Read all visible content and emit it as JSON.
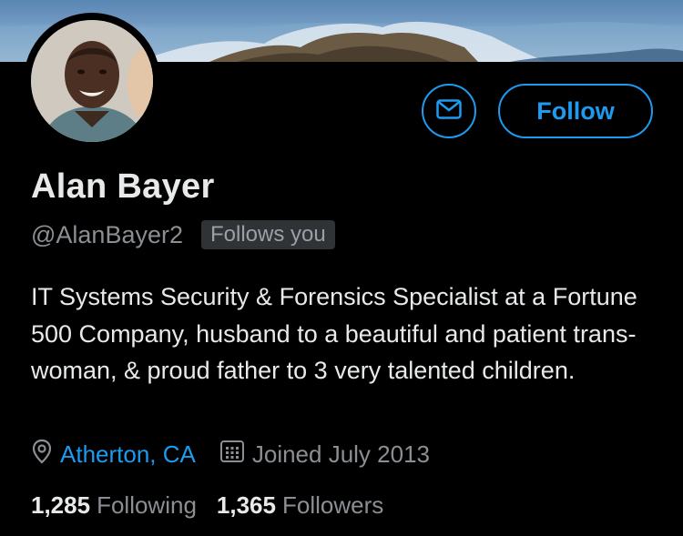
{
  "profile": {
    "name": "Alan Bayer",
    "handle": "@AlanBayer2",
    "follows_you": "Follows you",
    "bio": "IT Systems Security & Forensics Specialist at a Fortune 500 Company, husband to a beautiful and patient trans-woman, & proud father to 3 very talented children.",
    "location": "Atherton, CA",
    "joined": "Joined July 2013"
  },
  "actions": {
    "follow_label": "Follow",
    "message_icon": "mail-icon"
  },
  "stats": {
    "following_count": "1,285",
    "following_label": "Following",
    "followers_count": "1,365",
    "followers_label": "Followers"
  },
  "colors": {
    "accent": "#1d9bf0",
    "background": "#000000",
    "secondary_text": "#8b8f94",
    "badge_bg": "#2f3336"
  }
}
